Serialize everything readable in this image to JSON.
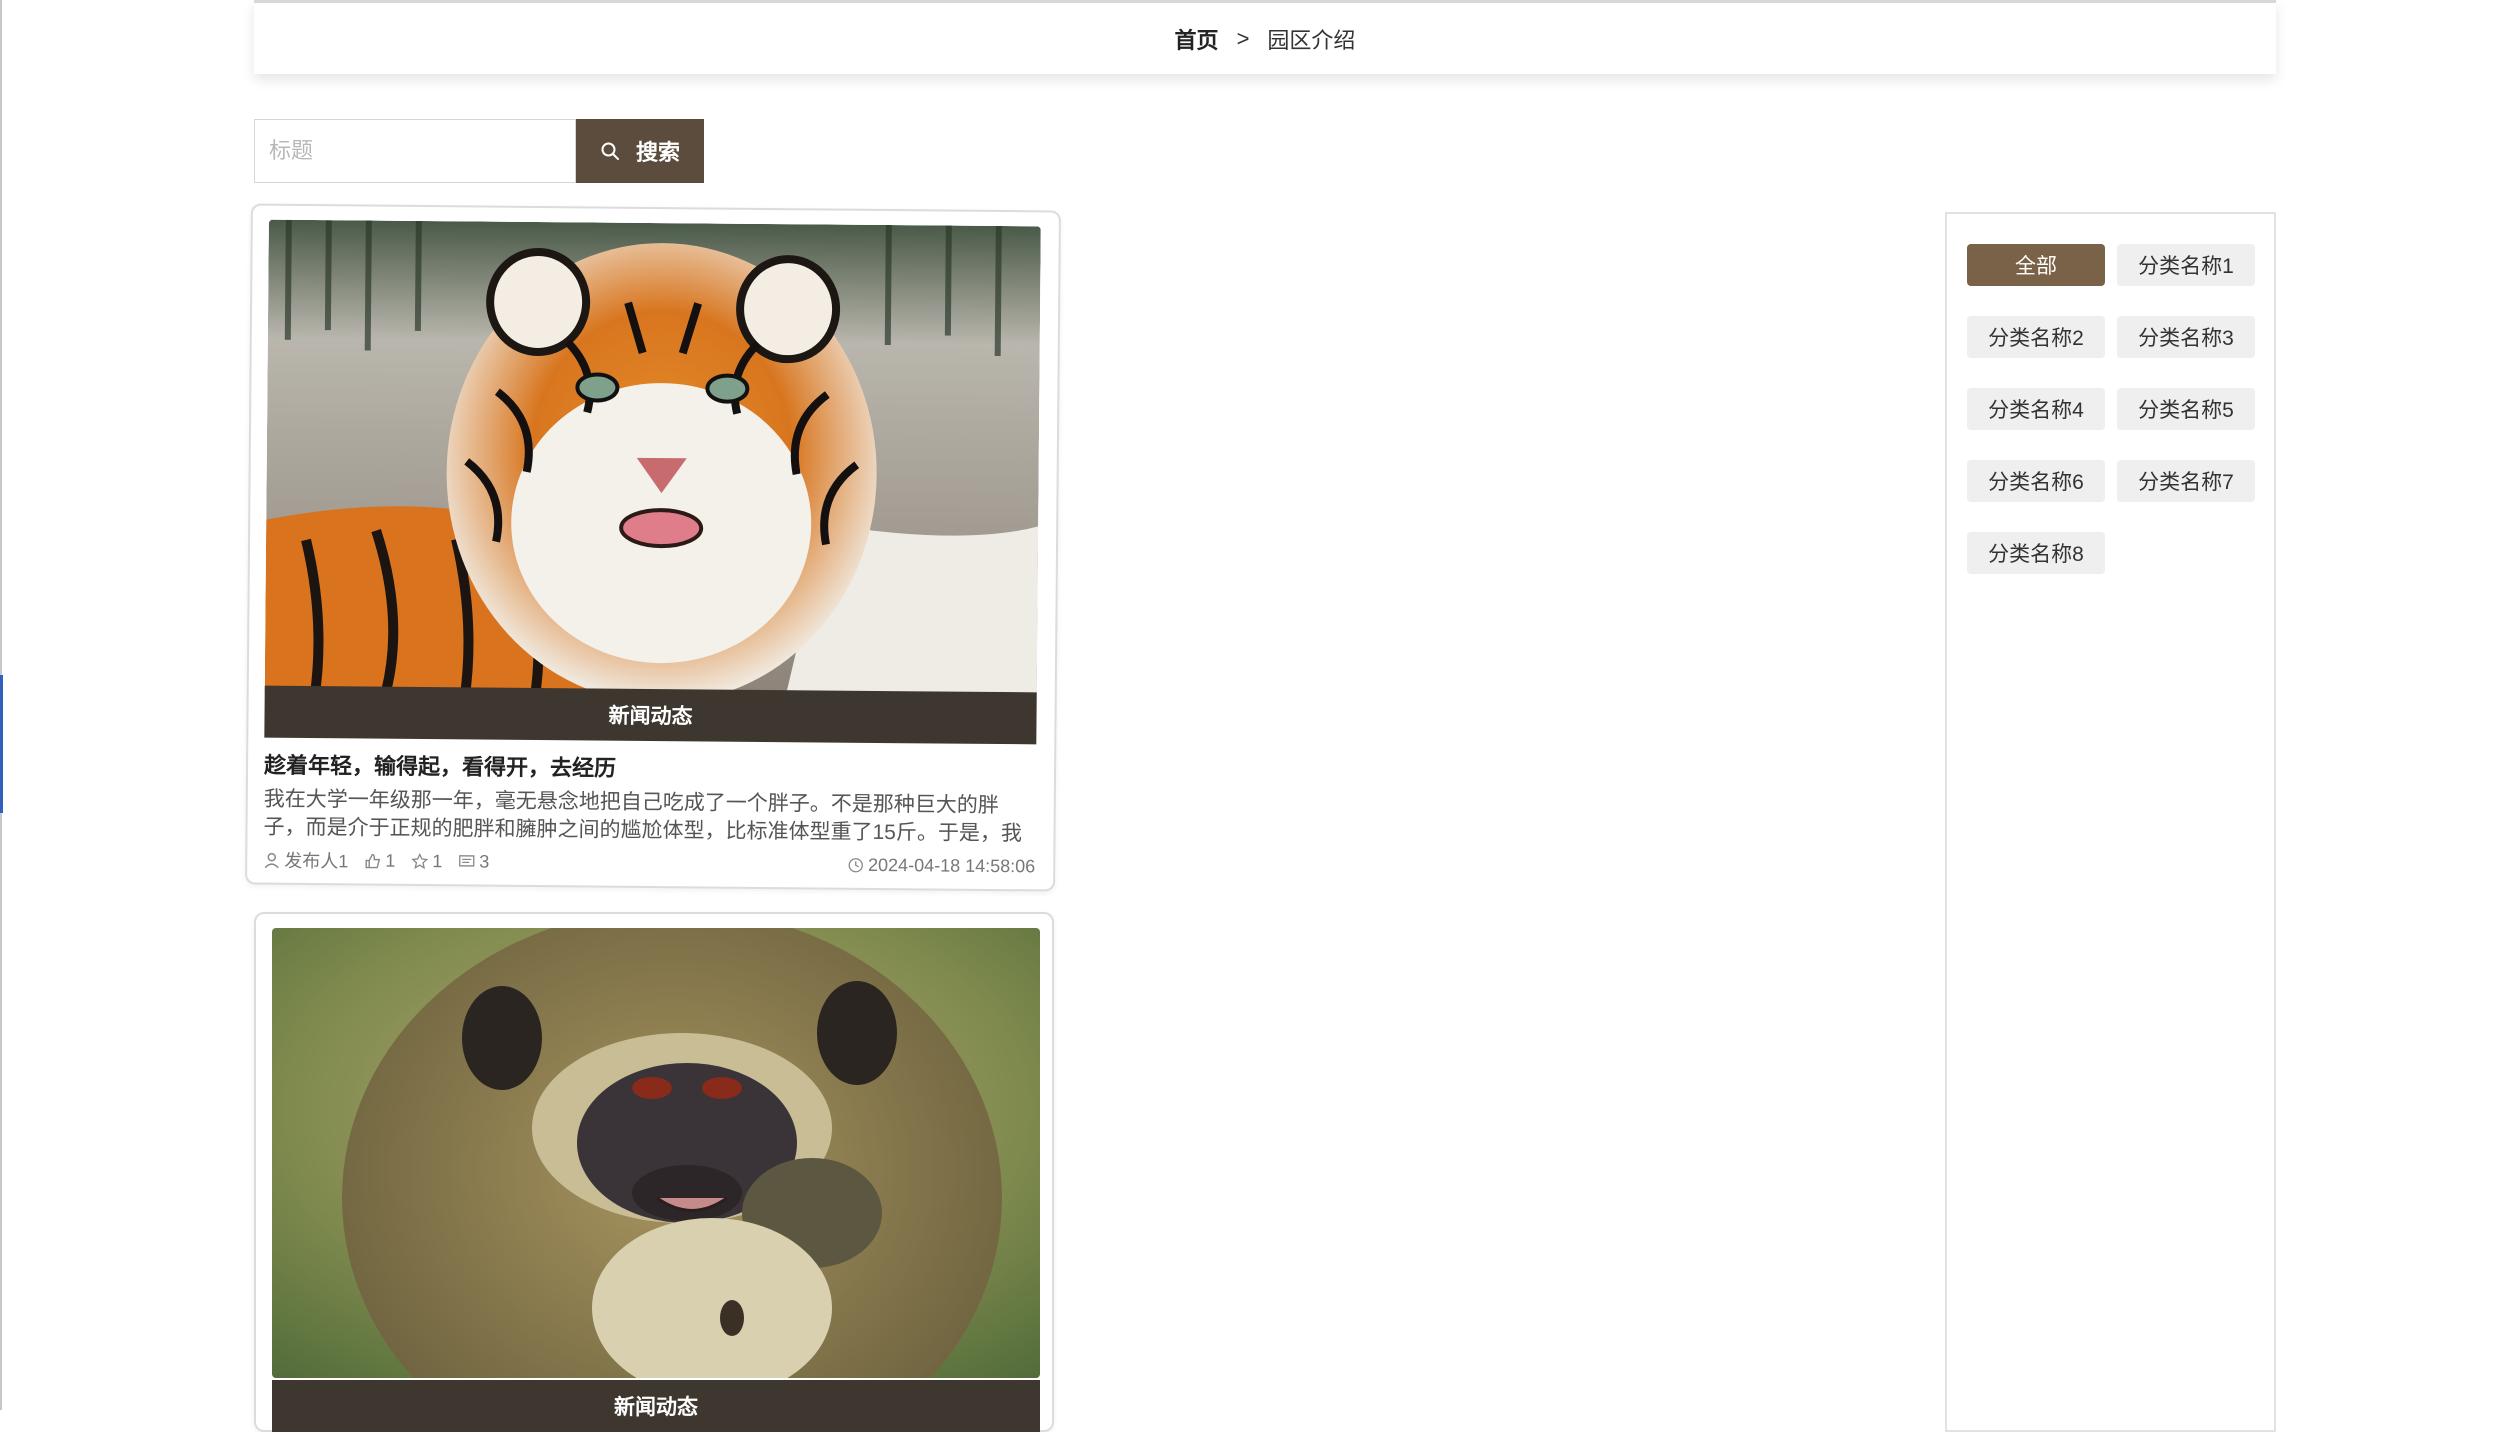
{
  "breadcrumb": {
    "home": "首页",
    "separator": ">",
    "current": "园区介绍"
  },
  "search": {
    "placeholder": "标题",
    "button_label": "搜索"
  },
  "cards": [
    {
      "category": "新闻动态",
      "title": "趁着年轻，输得起，看得开，去经历",
      "desc": "我在大学一年级那一年，毫无悬念地把自己吃成了一个胖子。不是那种巨大的胖子，而是介于正规的肥胖和臃肿之间的尴尬体型，比标准体型重了15斤。于是，我",
      "author": "发布人1",
      "likes": "1",
      "favorites": "1",
      "comments": "3",
      "time": "2024-04-18 14:58:06",
      "image": "tiger"
    },
    {
      "category": "新闻动态",
      "image": "monkey"
    }
  ],
  "categories": [
    "全部",
    "分类名称1",
    "分类名称2",
    "分类名称3",
    "分类名称4",
    "分类名称5",
    "分类名称6",
    "分类名称7",
    "分类名称8"
  ],
  "colors": {
    "accent": "#7a6248",
    "search_button": "#5b4c3d",
    "card_band": "#3d372f"
  }
}
